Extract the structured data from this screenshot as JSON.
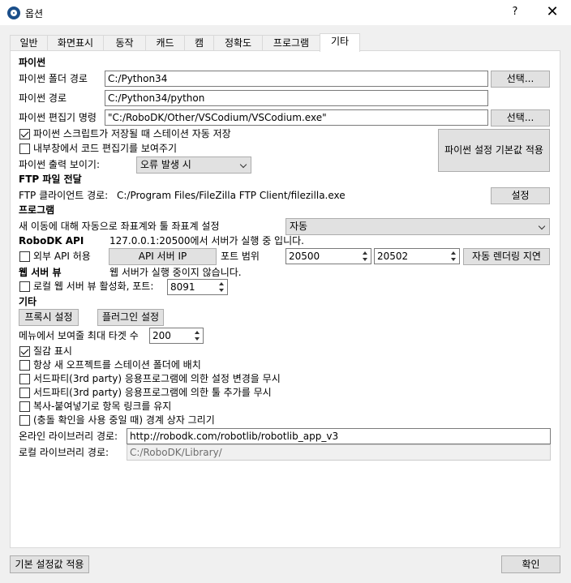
{
  "window": {
    "title": "옵션",
    "help": "?",
    "close": "✕"
  },
  "tabs": [
    "일반",
    "화면표시",
    "동작",
    "캐드",
    "캠",
    "정확도",
    "프로그램",
    "기타"
  ],
  "python": {
    "header": "파이썬",
    "folder_label": "파이썬 폴더 경로",
    "folder_value": "C:/Python34",
    "path_label": "파이썬 경로",
    "path_value": "C:/Python34/python",
    "editor_label": "파이썬 편집기 명령",
    "editor_value": "\"C:/RoboDK/Other/VSCodium/VSCodium.exe\"",
    "select_label": "선택...",
    "autosave_label": "파이썬 스크립트가 저장될 때 스테이션 자동 저장",
    "autosave_checked": true,
    "internal_editor_label": "내부창에서 코드 편집기를 보여주기",
    "internal_editor_checked": false,
    "output_label": "파이썬 출력 보이기:",
    "output_value": "오류 발생 시",
    "defaults_button": "파이썬 설정 기본값 적용"
  },
  "ftp": {
    "header": "FTP 파일 전달",
    "client_label": "FTP 클라이언트 경로:",
    "client_value": "C:/Program Files/FileZilla FTP Client/filezilla.exe",
    "settings_button": "설정"
  },
  "program": {
    "header": "프로그램",
    "coord_label": "새 이동에 대해 자동으로 좌표계와 툴 좌표계 설정",
    "coord_value": "자동"
  },
  "api": {
    "header": "RoboDK API",
    "status": "127.0.0.1:20500에서 서버가 실행 중 입니다.",
    "external_label": "외부 API 허용",
    "external_checked": false,
    "server_ip_button": "API 서버 IP",
    "port_range_label": "포트 범위",
    "port_from": "20500",
    "port_to": "20502",
    "render_delay_button": "자동 렌더링 지연"
  },
  "web": {
    "header": "웹 서버 뷰",
    "status": "웹 서버가 실행 중이지 않습니다.",
    "local_label": "로컬 웹 서버 뷰 활성화, 포트:",
    "local_checked": false,
    "port_value": "8091"
  },
  "misc": {
    "header": "기타",
    "proxy_button": "프록시 설정",
    "plugin_button": "플러그인 설정",
    "max_targets_label": "메뉴에서 보여줄 최대 타겟 수",
    "max_targets_value": "200",
    "checkboxes": [
      {
        "label": "질감 표시",
        "checked": true
      },
      {
        "label": "항상 새 오프젝트를 스테이션 폴더에 배치",
        "checked": false
      },
      {
        "label": "서드파티(3rd party) 응용프로그램에 의한 설정 변경을 무시",
        "checked": false
      },
      {
        "label": "서드파티(3rd party) 응용프로그램에 의한 툴 추가를 무시",
        "checked": false
      },
      {
        "label": "복사-붙여넣기로 항목 링크를 유지",
        "checked": false
      },
      {
        "label": "(충돌 확인을 사용 중일 때) 경계 상자 그리기",
        "checked": false
      }
    ],
    "online_lib_label": "온라인 라이브러리 경로:",
    "online_lib_value": "http://robodk.com/robotlib/robotlib_app_v3",
    "local_lib_label": "로컬 라이브러리 경로:",
    "local_lib_value": "C:/RoboDK/Library/"
  },
  "footer": {
    "defaults_button": "기본 설정값 적용",
    "ok_button": "확인"
  }
}
